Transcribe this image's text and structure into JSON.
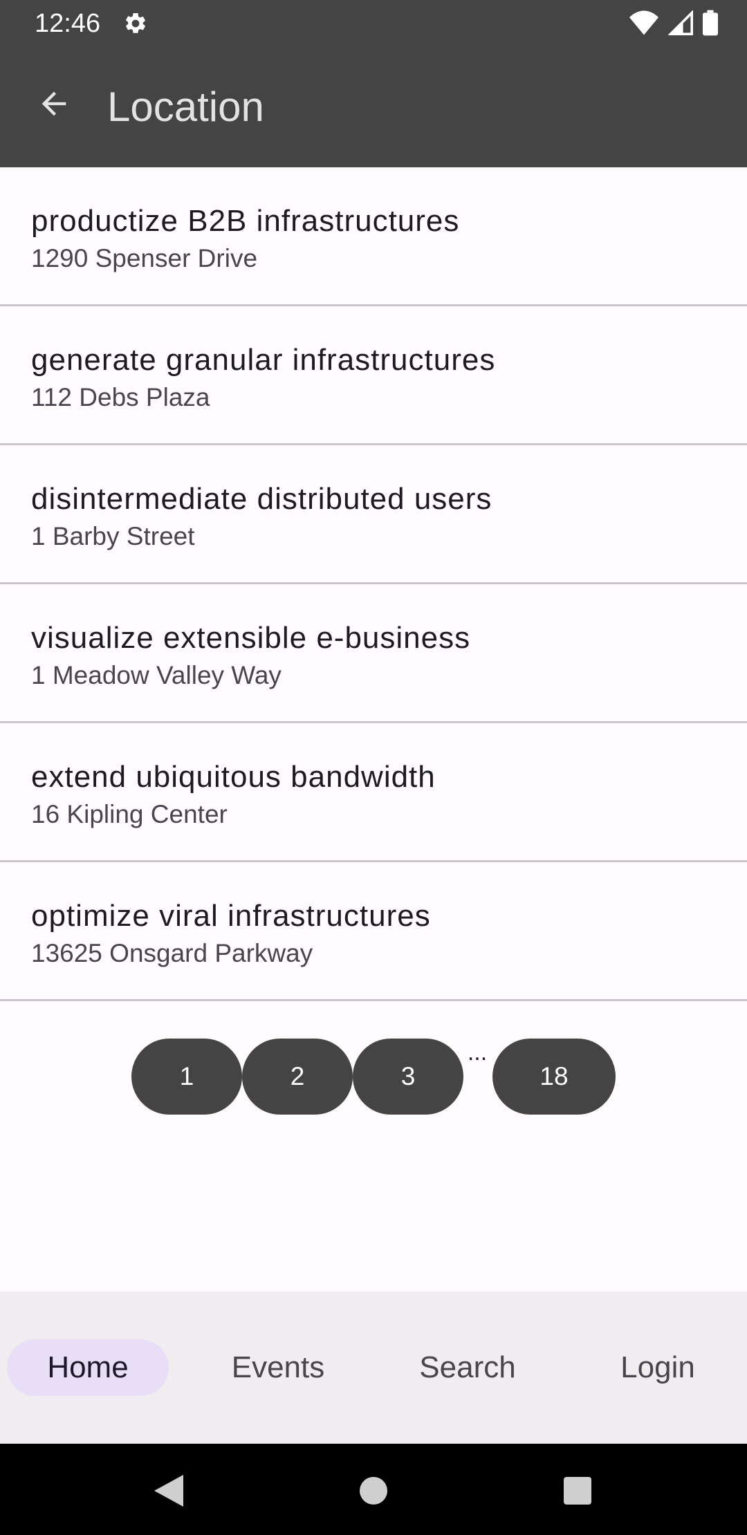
{
  "status_bar": {
    "time": "12:46",
    "icons": [
      "gear-icon",
      "wifi-icon",
      "signal-icon",
      "battery-icon"
    ]
  },
  "app_bar": {
    "title": "Location",
    "back_icon": "arrow-back-icon",
    "background": "#444444"
  },
  "locations": [
    {
      "title": "productize B2B infrastructures",
      "address": "1290 Spenser Drive"
    },
    {
      "title": "generate granular infrastructures",
      "address": "112 Debs Plaza"
    },
    {
      "title": "disintermediate distributed users",
      "address": "1 Barby Street"
    },
    {
      "title": "visualize extensible e-business",
      "address": "1 Meadow Valley Way"
    },
    {
      "title": "extend ubiquitous bandwidth",
      "address": "16 Kipling Center"
    },
    {
      "title": "optimize viral infrastructures",
      "address": "13625 Onsgard Parkway"
    }
  ],
  "pagination": {
    "pages": [
      "1",
      "2",
      "3",
      "18"
    ],
    "ellipsis": "..."
  },
  "bottom_nav": {
    "items": [
      {
        "label": "Home",
        "active": true
      },
      {
        "label": "Events",
        "active": false
      },
      {
        "label": "Search",
        "active": false
      },
      {
        "label": "Login",
        "active": false
      }
    ],
    "active_color": "#e8def8"
  },
  "system_nav": [
    "back-triangle-icon",
    "home-circle-icon",
    "recents-square-icon"
  ]
}
